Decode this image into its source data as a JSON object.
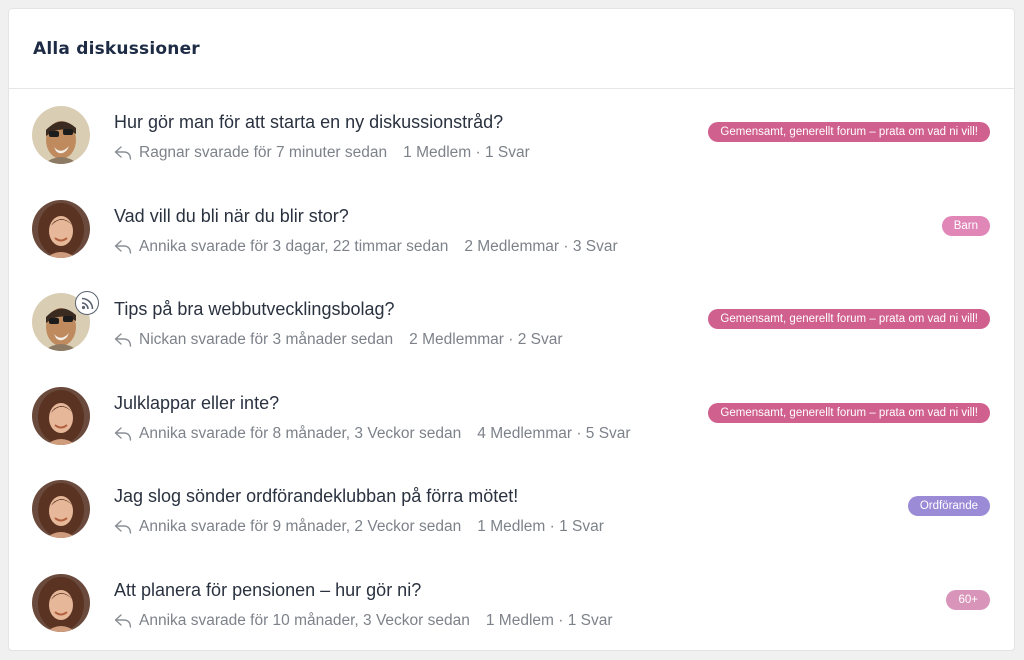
{
  "header": {
    "title": "Alla diskussioner"
  },
  "topics": [
    {
      "title": "Hur gör man för att starta en ny diskussionstråd?",
      "reply_text": "Ragnar svarade för 7 minuter sedan",
      "stats": "1 Medlem · 1 Svar",
      "badge": "Gemensamt, generellt forum – prata om vad ni vill!",
      "badge_color": "#d0608e",
      "avatar": "man"
    },
    {
      "title": "Vad vill du bli när du blir stor?",
      "reply_text": "Annika svarade för 3 dagar, 22 timmar sedan",
      "stats": "2 Medlemmar · 3 Svar",
      "badge": "Barn",
      "badge_color": "#e087b8",
      "avatar": "woman"
    },
    {
      "title": "Tips på bra webbutvecklingsbolag?",
      "reply_text": "Nickan svarade för 3 månader sedan",
      "stats": "2 Medlemmar · 2 Svar",
      "badge": "Gemensamt, generellt forum – prata om vad ni vill!",
      "badge_color": "#d0608e",
      "avatar": "man",
      "subscribed_icon": "rss-icon"
    },
    {
      "title": "Julklappar eller inte?",
      "reply_text": "Annika svarade för 8 månader, 3 Veckor sedan",
      "stats": "4 Medlemmar · 5 Svar",
      "badge": "Gemensamt, generellt forum – prata om vad ni vill!",
      "badge_color": "#d0608e",
      "avatar": "woman"
    },
    {
      "title": "Jag slog sönder ordförandeklubban på förra mötet!",
      "reply_text": "Annika svarade för 9 månader, 2 Veckor sedan",
      "stats": "1 Medlem · 1 Svar",
      "badge": "Ordförande",
      "badge_color": "#9b8bd6",
      "avatar": "woman"
    },
    {
      "title": "Att planera för pensionen – hur gör ni?",
      "reply_text": "Annika svarade för 10 månader, 3 Veckor sedan",
      "stats": "1 Medlem · 1 Svar",
      "badge": "60+",
      "badge_color": "#d995b9",
      "avatar": "woman"
    }
  ]
}
